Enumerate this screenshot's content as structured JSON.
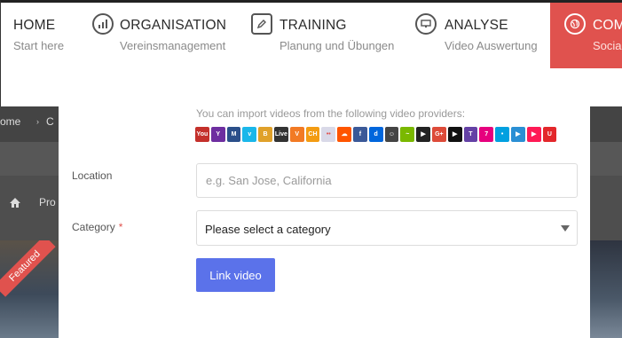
{
  "nav": {
    "items": [
      {
        "title": "HOME",
        "subtitle": "Start here",
        "icon": "none"
      },
      {
        "title": "ORGANISATION",
        "subtitle": "Vereinsmanagement",
        "icon": "bar-chart-icon"
      },
      {
        "title": "TRAINING",
        "subtitle": "Planung und Übungen",
        "icon": "edit-icon"
      },
      {
        "title": "ANALYSE",
        "subtitle": "Video Auswertung",
        "icon": "monitor-icon"
      },
      {
        "title": "COM",
        "subtitle": "Social",
        "icon": "globe-icon"
      }
    ],
    "active_color": "#e0524e"
  },
  "background": {
    "breadcrumb_home": "ome",
    "breadcrumb_sep": "›",
    "breadcrumb_next": "C",
    "section_label": "Pro",
    "ribbon": "Featured"
  },
  "form": {
    "providers_note": "You can import videos from the following video providers:",
    "providers": [
      {
        "name": "YouTube",
        "color": "#c4302b",
        "glyph": "You"
      },
      {
        "name": "Yahoo",
        "color": "#6e2ea0",
        "glyph": "Y"
      },
      {
        "name": "Metacafe",
        "color": "#2b4f8a",
        "glyph": "M"
      },
      {
        "name": "Vimeo",
        "color": "#1ab7ea",
        "glyph": "v"
      },
      {
        "name": "Break",
        "color": "#e0a12a",
        "glyph": "B"
      },
      {
        "name": "LiveLeak",
        "color": "#333333",
        "glyph": "Live"
      },
      {
        "name": "Vine",
        "color": "#f27a24",
        "glyph": "V"
      },
      {
        "name": "CollegeHumor",
        "color": "#f39c12",
        "glyph": "CH"
      },
      {
        "name": "Flickr",
        "color": "#d9d9e8",
        "glyph": "••"
      },
      {
        "name": "SoundCloud",
        "color": "#ff5500",
        "glyph": "☁"
      },
      {
        "name": "Facebook",
        "color": "#3b5998",
        "glyph": "f"
      },
      {
        "name": "Dailymotion",
        "color": "#0066dc",
        "glyph": "d"
      },
      {
        "name": "Funnyordie",
        "color": "#444444",
        "glyph": "☺"
      },
      {
        "name": "Myvideo",
        "color": "#7ab800",
        "glyph": "~"
      },
      {
        "name": "Vevo",
        "color": "#222222",
        "glyph": "▶"
      },
      {
        "name": "Google+",
        "color": "#dd4b39",
        "glyph": "G+"
      },
      {
        "name": "Veoh",
        "color": "#111111",
        "glyph": "▶"
      },
      {
        "name": "Twitch",
        "color": "#6441a5",
        "glyph": "T"
      },
      {
        "name": "Seven",
        "color": "#e6007e",
        "glyph": "7"
      },
      {
        "name": "Clipfish",
        "color": "#00a0e0",
        "glyph": "•"
      },
      {
        "name": "Sevenload",
        "color": "#2a8fd4",
        "glyph": "▶"
      },
      {
        "name": "MyVideo",
        "color": "#ff1a55",
        "glyph": "▶"
      },
      {
        "name": "Ustream",
        "color": "#e3272b",
        "glyph": "U"
      }
    ],
    "location_label": "Location",
    "location_placeholder": "e.g. San Jose, California",
    "category_label": "Category",
    "required_mark": "*",
    "category_value": "Please select a category",
    "submit_label": "Link video",
    "button_color": "#5b72ea"
  }
}
